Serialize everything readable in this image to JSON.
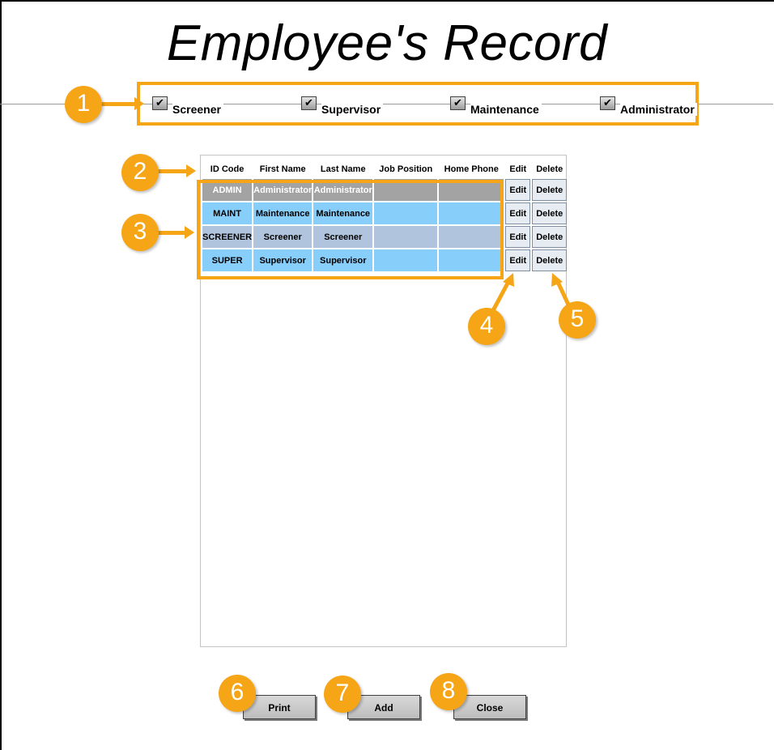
{
  "title": "Employee's Record",
  "filters": [
    {
      "label": "Screener",
      "checked": true
    },
    {
      "label": "Supervisor",
      "checked": true
    },
    {
      "label": "Maintenance",
      "checked": true
    },
    {
      "label": "Administrator",
      "checked": true
    }
  ],
  "table": {
    "headers": [
      "ID Code",
      "First Name",
      "Last Name",
      "Job Position",
      "Home Phone",
      "Edit",
      "Delete"
    ],
    "rows": [
      {
        "id": "ADMIN",
        "first": "Administrator",
        "last": "Administrator",
        "job": "",
        "phone": ""
      },
      {
        "id": "MAINT",
        "first": "Maintenance",
        "last": "Maintenance",
        "job": "",
        "phone": ""
      },
      {
        "id": "SCREENER",
        "first": "Screener",
        "last": "Screener",
        "job": "",
        "phone": ""
      },
      {
        "id": "SUPER",
        "first": "Supervisor",
        "last": "Supervisor",
        "job": "",
        "phone": ""
      }
    ],
    "edit_label": "Edit",
    "delete_label": "Delete"
  },
  "buttons": {
    "print": "Print",
    "add": "Add",
    "close": "Close"
  },
  "callouts": [
    "1",
    "2",
    "3",
    "4",
    "5",
    "6",
    "7",
    "8"
  ],
  "colors": {
    "callout": "#f5a516",
    "row_admin": "#a3a3a3",
    "row_blue": "#87cefa",
    "row_grey": "#b0c4de"
  }
}
